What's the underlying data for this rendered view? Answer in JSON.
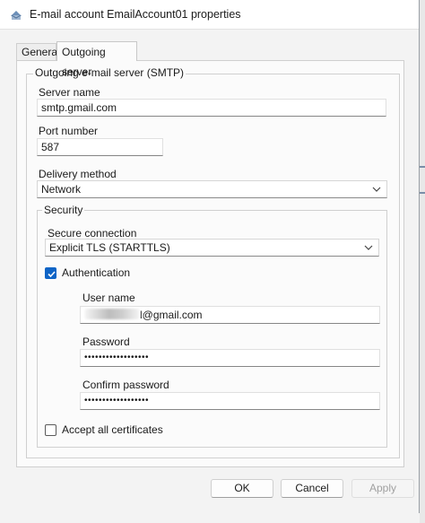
{
  "window": {
    "title": "E-mail account EmailAccount01 properties"
  },
  "tabs": [
    {
      "label": "General",
      "active": false
    },
    {
      "label": "Outgoing server",
      "active": true
    }
  ],
  "smtp": {
    "group_label": "Outgoing e-mail server (SMTP)",
    "server_name_label": "Server name",
    "server_name": "smtp.gmail.com",
    "port_label": "Port number",
    "port": "587",
    "delivery_label": "Delivery method",
    "delivery": "Network"
  },
  "security": {
    "group_label": "Security",
    "secure_connection_label": "Secure connection",
    "secure_connection": "Explicit TLS (STARTTLS)",
    "authentication_label": "Authentication",
    "authentication_checked": true,
    "username_label": "User name",
    "username_suffix": "l@gmail.com",
    "password_label": "Password",
    "password_mask": "••••••••••••••••••",
    "confirm_label": "Confirm password",
    "confirm_mask": "••••••••••••••••••",
    "accept_label": "Accept all certificates",
    "accept_checked": false
  },
  "buttons": {
    "ok": "OK",
    "cancel": "Cancel",
    "apply": "Apply"
  },
  "colors": {
    "accent": "#0f64c6",
    "background": "#f3f3f3"
  },
  "icons": {
    "app": "mail-server-icon",
    "dropdown": "chevron-down-icon",
    "check": "checkmark-icon"
  }
}
